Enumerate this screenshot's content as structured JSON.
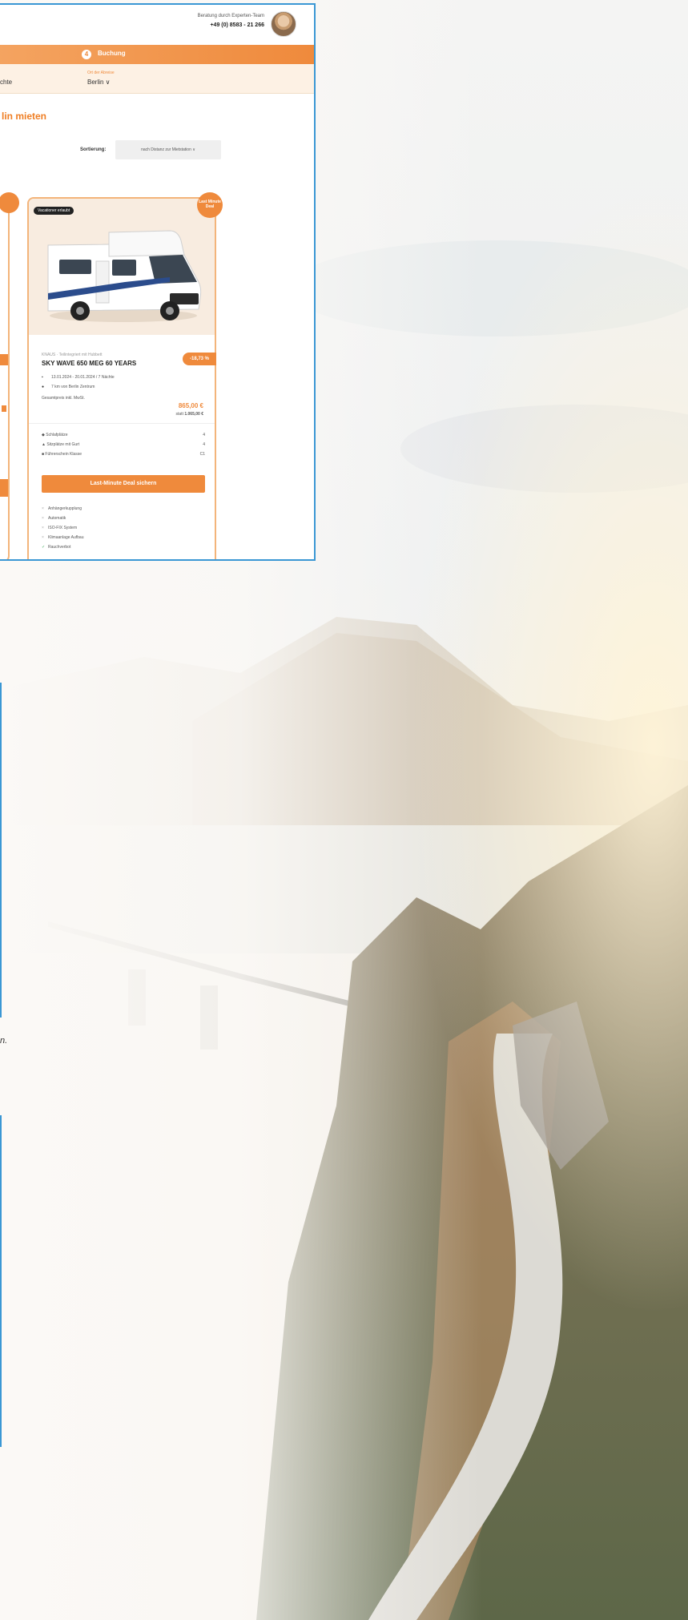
{
  "header": {
    "advice_line1": "Beratung durch Experten-Team",
    "advice_line2": "+49 (0) 8583 - 21 266"
  },
  "steps": {
    "active_number": "4",
    "active_label": "Buchung"
  },
  "filter": {
    "left_value": "chte",
    "location_label": "Ort der Abreise",
    "location_value": "Berlin ∨"
  },
  "page_title": "lin mieten",
  "sort": {
    "label": "Sortierung:",
    "value": "nach Distanz zur Mietstation ∨"
  },
  "card": {
    "badge": "Vacationer erlaubt",
    "last_minute": "Last Minute Deal",
    "subtitle": "KNAUS · Teilintegriert mit Hubbett",
    "model": "SKY WAVE 650 MEG 60 YEARS",
    "discount": "-18,73 %",
    "dates": "13.01.2024 - 20.01.2024 / 7 Nächte",
    "distance": "7 km von Berlin Zentrum",
    "total_label": "Gesamtpreis inkl. MwSt.",
    "price": "865,00 €",
    "price_prefix": "statt",
    "price_old": "1.065,00 €",
    "specs": [
      {
        "label": "Schlafplätze",
        "value": "4"
      },
      {
        "label": "Sitzplätze mit Gurt",
        "value": "4"
      },
      {
        "label": "Führerschein Klasse",
        "value": "C1"
      }
    ],
    "cta": "Last-Minute Deal sichern",
    "features": [
      "Anhängerkupplung",
      "Automatik",
      "ISO-FIX System",
      "Klimaanlage Aufbau",
      "Rauchverbot"
    ]
  },
  "caption": "n."
}
